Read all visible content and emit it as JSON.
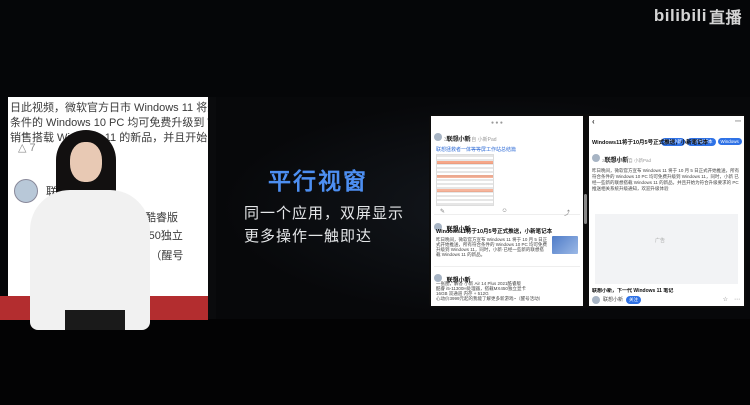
{
  "watermark": {
    "brand": "bilibili",
    "suffix": "直播"
  },
  "left_post": {
    "lines": [
      "日此视频，微软官方日市 Windows 11 将永",
      "条件的 Windows 10 PC 均可免费升级到 Win",
      "销售搭载 Windows 11 的新品，并且开始为用"
    ],
    "like_count": "7",
    "author_name": "联想",
    "body_lines": [
      "s 2021酷睿版",
      "MX450独立",
      "~（醒号"
    ]
  },
  "slide": {
    "title": "平行视窗",
    "line1": "同一个应用，双屏显示",
    "line2": "更多操作一触即达"
  },
  "tablet": {
    "left": {
      "top_status": "● ● ●",
      "card1": {
        "user": "联想小新",
        "meta": "3小时前 · 来自 小新Pad",
        "tag": "联想拯救者一体等等屏工作站总结篇"
      },
      "card1_actions": [
        "✎",
        "☺",
        "⤴"
      ],
      "card2": {
        "user": "联想小新",
        "meta": "5小时前",
        "title": "Windows11将于10月5号正式推送，小新笔记本",
        "body": "昨日晚间，微软官方宣布 Windows 11 将于 10 月 5 日正式开始推送，所有符合条件的 Windows 10 PC 均可免费升级到 Windows 11，同时，小新·已经一些新的联想搭载 Windows 11 的新品。"
      },
      "card3": {
        "user": "联想小新",
        "meta": "6小时前",
        "body": "一张图，解答 小新 Air 14 Plus 2021酷睿版\n酷睿 i5-11300H处理器，搭载MX450独立显卡\n16GB 双通道 内存 + 512G\n心动价3999元起的我能了解更多新游戏~（醒号活动）"
      }
    },
    "right": {
      "back_label": "‹",
      "more_label": "⋯",
      "tags": [
        "联想小新",
        "小新笔记本",
        "Windows"
      ],
      "title": "Windows11将于10月5号正式推送，小新笔记本",
      "user": "联想小新",
      "meta": "2021-9-10 来自 小新Pad",
      "body": "昨日晚间，微软官方宣布 Windows 11 将于 10 月 5 日正式开始推送，所有符合条件的 Windows 10 PC 均可免费升级到 Windows 11，同时，小新 已经一些新的联想搭载 Windows 11 的新品，并且开始为符合升级要求的 PC 推送相关系统升级通知，欢迎升级体验",
      "ad_label": "广告",
      "footer_title": "联想小新，下一代 Windows 11 笔记",
      "footer_user": "联想小新",
      "footer_tag": "关注",
      "footer_actions": [
        "☆",
        "⋯"
      ]
    }
  },
  "colors": {
    "title_blue": "#4d8ff2",
    "accent_red": "#b32d2f",
    "pill_blue": "#2f72e6"
  }
}
